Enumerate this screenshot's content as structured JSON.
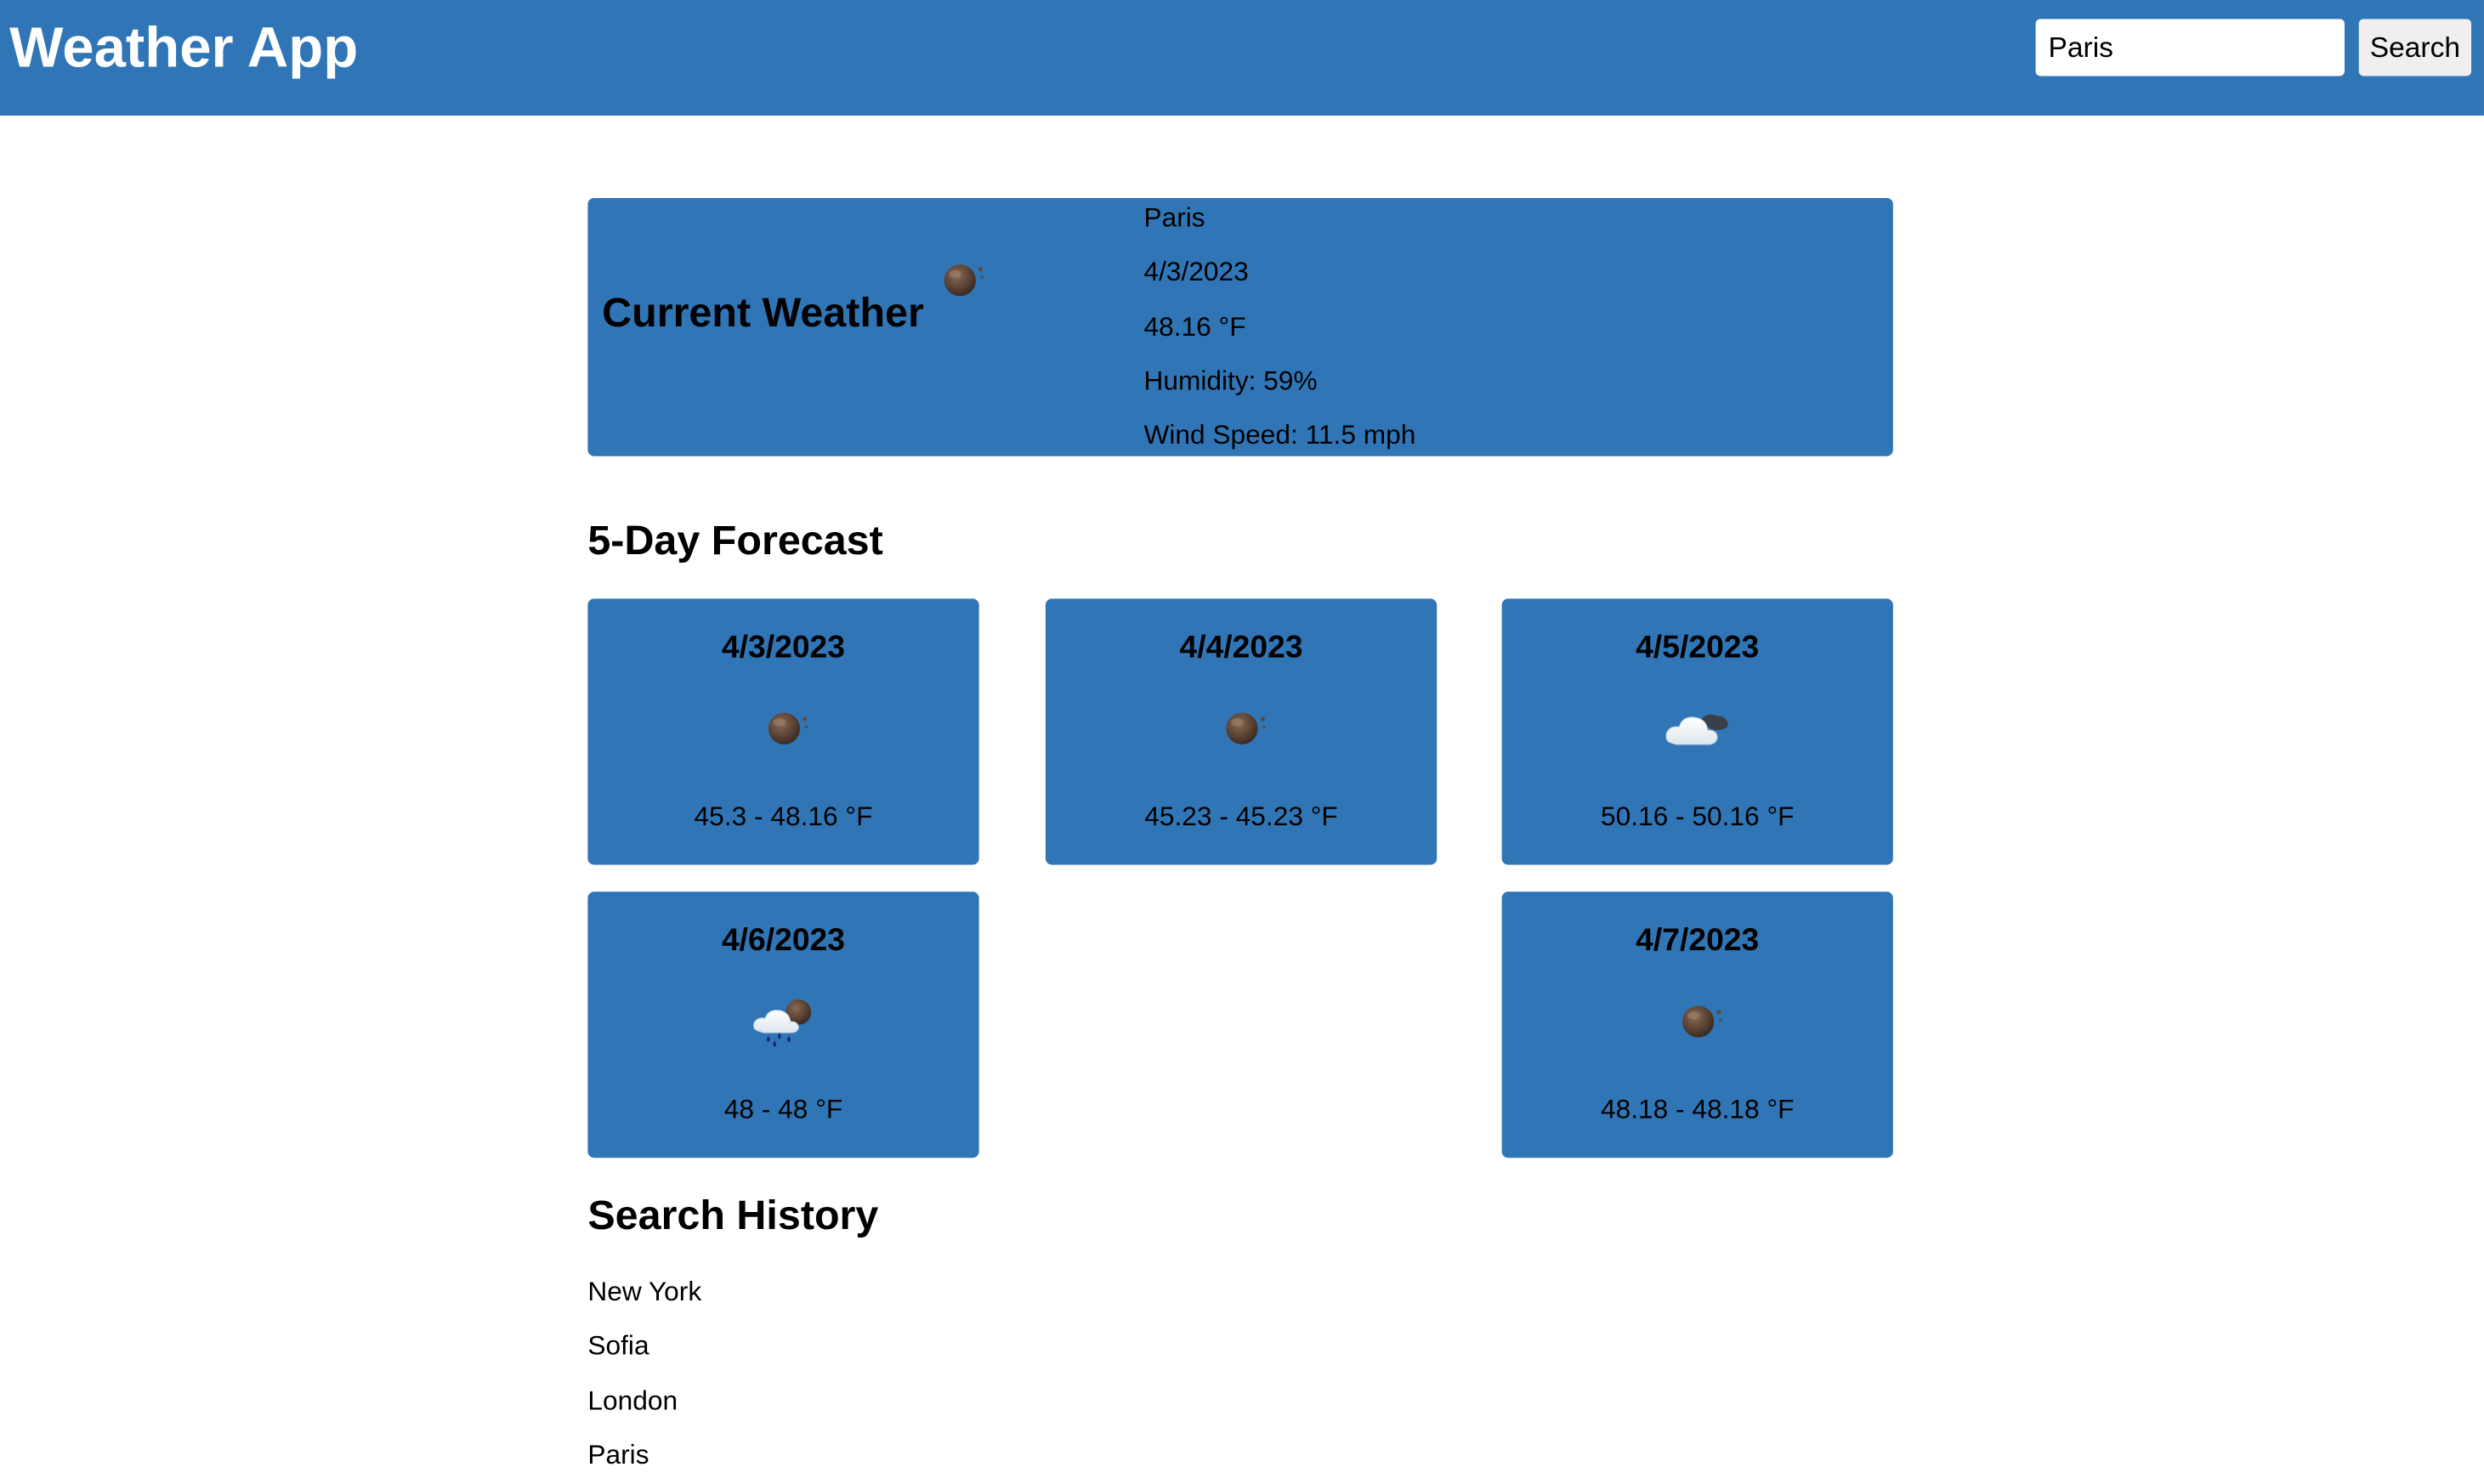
{
  "header": {
    "title": "Weather App",
    "search_value": "Paris",
    "search_button": "Search"
  },
  "current": {
    "title": "Current Weather",
    "icon": "few-clouds-night-icon",
    "city": "Paris",
    "date": "4/3/2023",
    "temp": "48.16 °F",
    "humidity": "Humidity: 59%",
    "wind": "Wind Speed: 11.5 mph"
  },
  "forecast": {
    "title": "5-Day Forecast",
    "days": [
      {
        "date": "4/3/2023",
        "icon": "moon-clouds-icon",
        "temp": "45.3 - 48.16 °F"
      },
      {
        "date": "4/4/2023",
        "icon": "moon-clouds-icon",
        "temp": "45.23 - 45.23 °F"
      },
      {
        "date": "4/5/2023",
        "icon": "cloudy-night-icon",
        "temp": "50.16 - 50.16 °F"
      },
      {
        "date": "4/6/2023",
        "icon": "rain-night-icon",
        "temp": "48 - 48 °F"
      },
      {
        "date": "4/7/2023",
        "icon": "moon-clouds-icon",
        "temp": "48.18 - 48.18 °F"
      }
    ]
  },
  "history": {
    "title": "Search History",
    "items": [
      "New York",
      "Sofia",
      "London",
      "Paris"
    ]
  },
  "colors": {
    "primary": "#3076b7",
    "text": "#000000",
    "background": "#ffffff"
  }
}
